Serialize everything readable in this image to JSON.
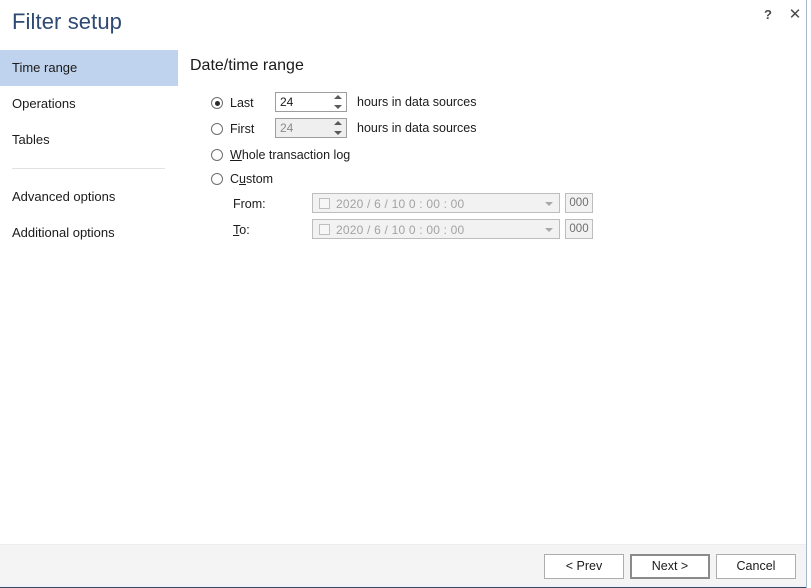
{
  "window": {
    "title": "Filter setup",
    "help_icon": "question-mark-icon",
    "close_icon": "close-icon",
    "help_label": "?",
    "close_label": "✕"
  },
  "sidebar": {
    "items": [
      {
        "label": "Time range",
        "selected": true
      },
      {
        "label": "Operations",
        "selected": false
      },
      {
        "label": "Tables",
        "selected": false
      }
    ],
    "secondary_items": [
      {
        "label": "Advanced options"
      },
      {
        "label": "Additional options"
      }
    ]
  },
  "main": {
    "heading": "Date/time range",
    "options": [
      {
        "id": "last",
        "label": "Last",
        "selected": true,
        "value": "24",
        "suffix": "hours in data sources",
        "disabled": false
      },
      {
        "id": "first",
        "label": "First",
        "selected": false,
        "value": "24",
        "suffix": "hours in data sources",
        "disabled": true
      },
      {
        "id": "whole-transaction-log",
        "label_pre": "W",
        "label_post": "hole transaction log",
        "selected": false
      },
      {
        "id": "custom",
        "label_pre": "C",
        "label_mid": "u",
        "label_post": "stom",
        "selected": false
      }
    ],
    "date_rows": [
      {
        "id": "from",
        "label": "From:",
        "label_underline_char": "",
        "date_text": "2020 /   6 / 10      0 : 00 : 00",
        "ms": "000"
      },
      {
        "id": "to",
        "label_pre": "T",
        "label_post": "o:",
        "date_text": "2020 /   6 / 10      0 : 00 : 00",
        "ms": "000"
      }
    ]
  },
  "footer": {
    "prev_label": "< Prev",
    "next_label": "Next >",
    "cancel_label": "Cancel"
  },
  "colors": {
    "title_blue": "#2e4a72",
    "sidebar_selected": "#bfd3ee",
    "footer_bg": "#f4f4f4",
    "accent_line": "#3b4a63"
  }
}
